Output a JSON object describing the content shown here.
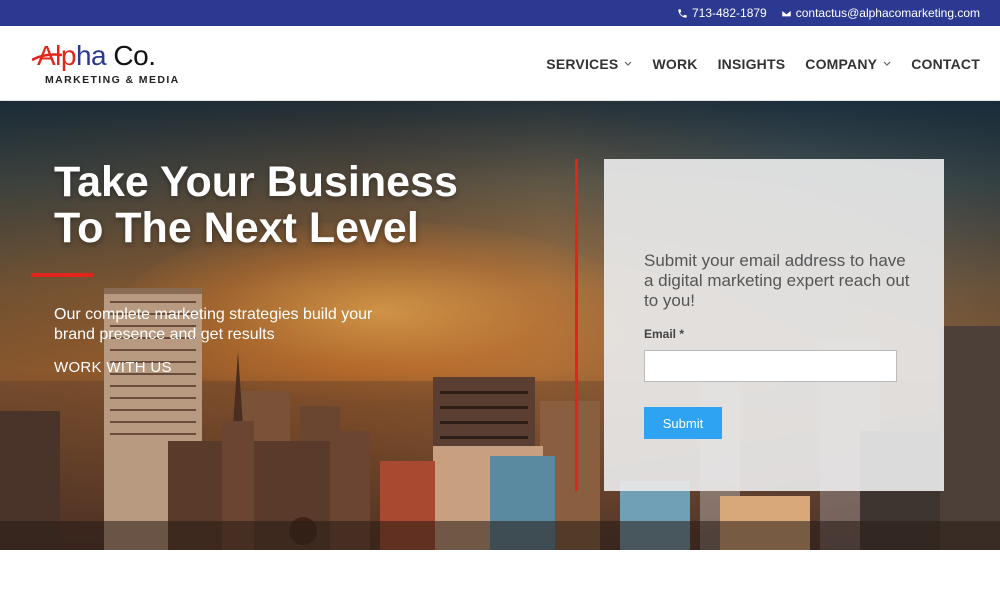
{
  "topbar": {
    "phone": "713-482-1879",
    "email": "contactus@alphacomarketing.com"
  },
  "logo": {
    "part1": "Alp",
    "part2": "ha",
    "part3": " Co.",
    "subtitle": "MARKETING & MEDIA"
  },
  "nav": {
    "items": [
      {
        "label": "SERVICES",
        "dropdown": true
      },
      {
        "label": "WORK",
        "dropdown": false
      },
      {
        "label": "INSIGHTS",
        "dropdown": false
      },
      {
        "label": "COMPANY",
        "dropdown": true
      },
      {
        "label": "CONTACT",
        "dropdown": false
      }
    ]
  },
  "hero": {
    "title_line1": "Take Your Business",
    "title_line2": "To The Next Level",
    "subtitle": "Our complete marketing strategies build your brand presence and get results",
    "cta": "WORK WITH US"
  },
  "form": {
    "prompt": "Submit your email address to have a digital marketing expert reach out to you!",
    "email_label": "Email",
    "required_marker": "*",
    "email_value": "",
    "submit_label": "Submit"
  },
  "colors": {
    "topbar_bg": "#2b3990",
    "accent_red": "#e0261b",
    "submit_blue": "#2ea3f2"
  }
}
